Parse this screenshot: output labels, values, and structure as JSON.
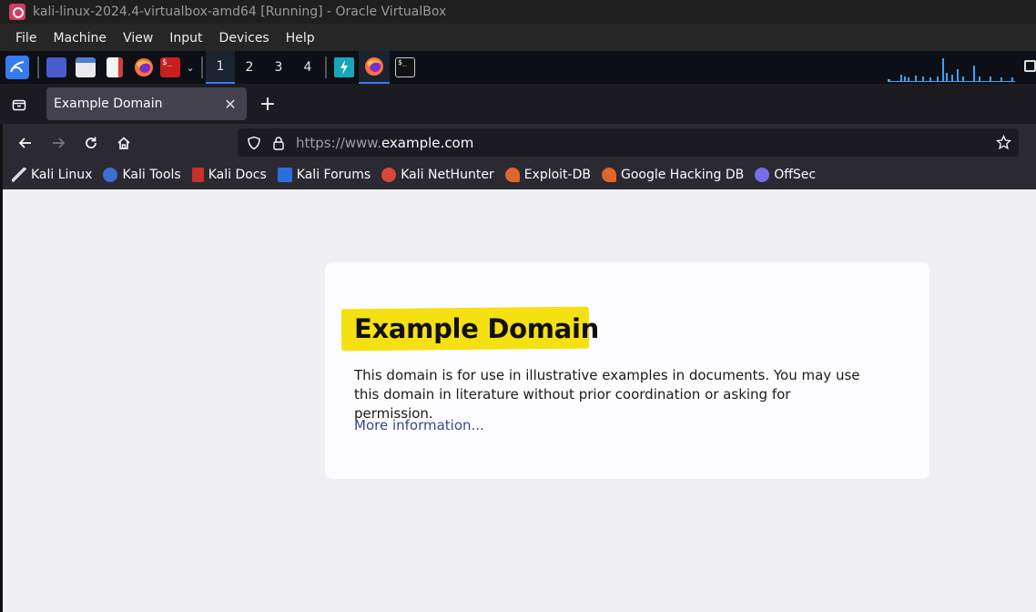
{
  "window": {
    "title": "kali-linux-2024.4-virtualbox-amd64 [Running] - Oracle VirtualBox"
  },
  "vbox_menu": [
    "File",
    "Machine",
    "View",
    "Input",
    "Devices",
    "Help"
  ],
  "kali_panel": {
    "workspaces": [
      "1",
      "2",
      "3",
      "4"
    ],
    "active_workspace": "1",
    "icons": [
      "kali-menu-icon",
      "desktop-icon",
      "file-manager-icon",
      "text-editor-icon",
      "firefox-icon",
      "terminal-icon",
      "chevron-down-icon",
      "burp-icon",
      "firefox-icon",
      "terminal-icon"
    ]
  },
  "browser": {
    "tab_title": "Example Domain",
    "url_scheme": "https://www.",
    "url_host": "example",
    "url_rest": ".com",
    "bookmarks": [
      {
        "label": "Kali Linux",
        "icon": "kali-dragon-icon",
        "color": "#222222"
      },
      {
        "label": "Kali Tools",
        "icon": "kali-tools-icon",
        "color": "#3b6fd6"
      },
      {
        "label": "Kali Docs",
        "icon": "kali-docs-icon",
        "color": "#c9302c"
      },
      {
        "label": "Kali Forums",
        "icon": "kali-forums-icon",
        "color": "#2a6fdb"
      },
      {
        "label": "Kali NetHunter",
        "icon": "nethunter-icon",
        "color": "#d9463c"
      },
      {
        "label": "Exploit-DB",
        "icon": "exploit-db-icon",
        "color": "#e0652a"
      },
      {
        "label": "Google Hacking DB",
        "icon": "ghdb-icon",
        "color": "#e0652a"
      },
      {
        "label": "OffSec",
        "icon": "offsec-icon",
        "color": "#7a6cf0"
      }
    ]
  },
  "page": {
    "heading": "Example Domain",
    "body": "This domain is for use in illustrative examples in documents. You may use this domain in literature without prior coordination or asking for permission.",
    "link": "More information..."
  },
  "colors": {
    "accent": "#367bf0",
    "highlight": "#f5e012",
    "link": "#38488f"
  }
}
